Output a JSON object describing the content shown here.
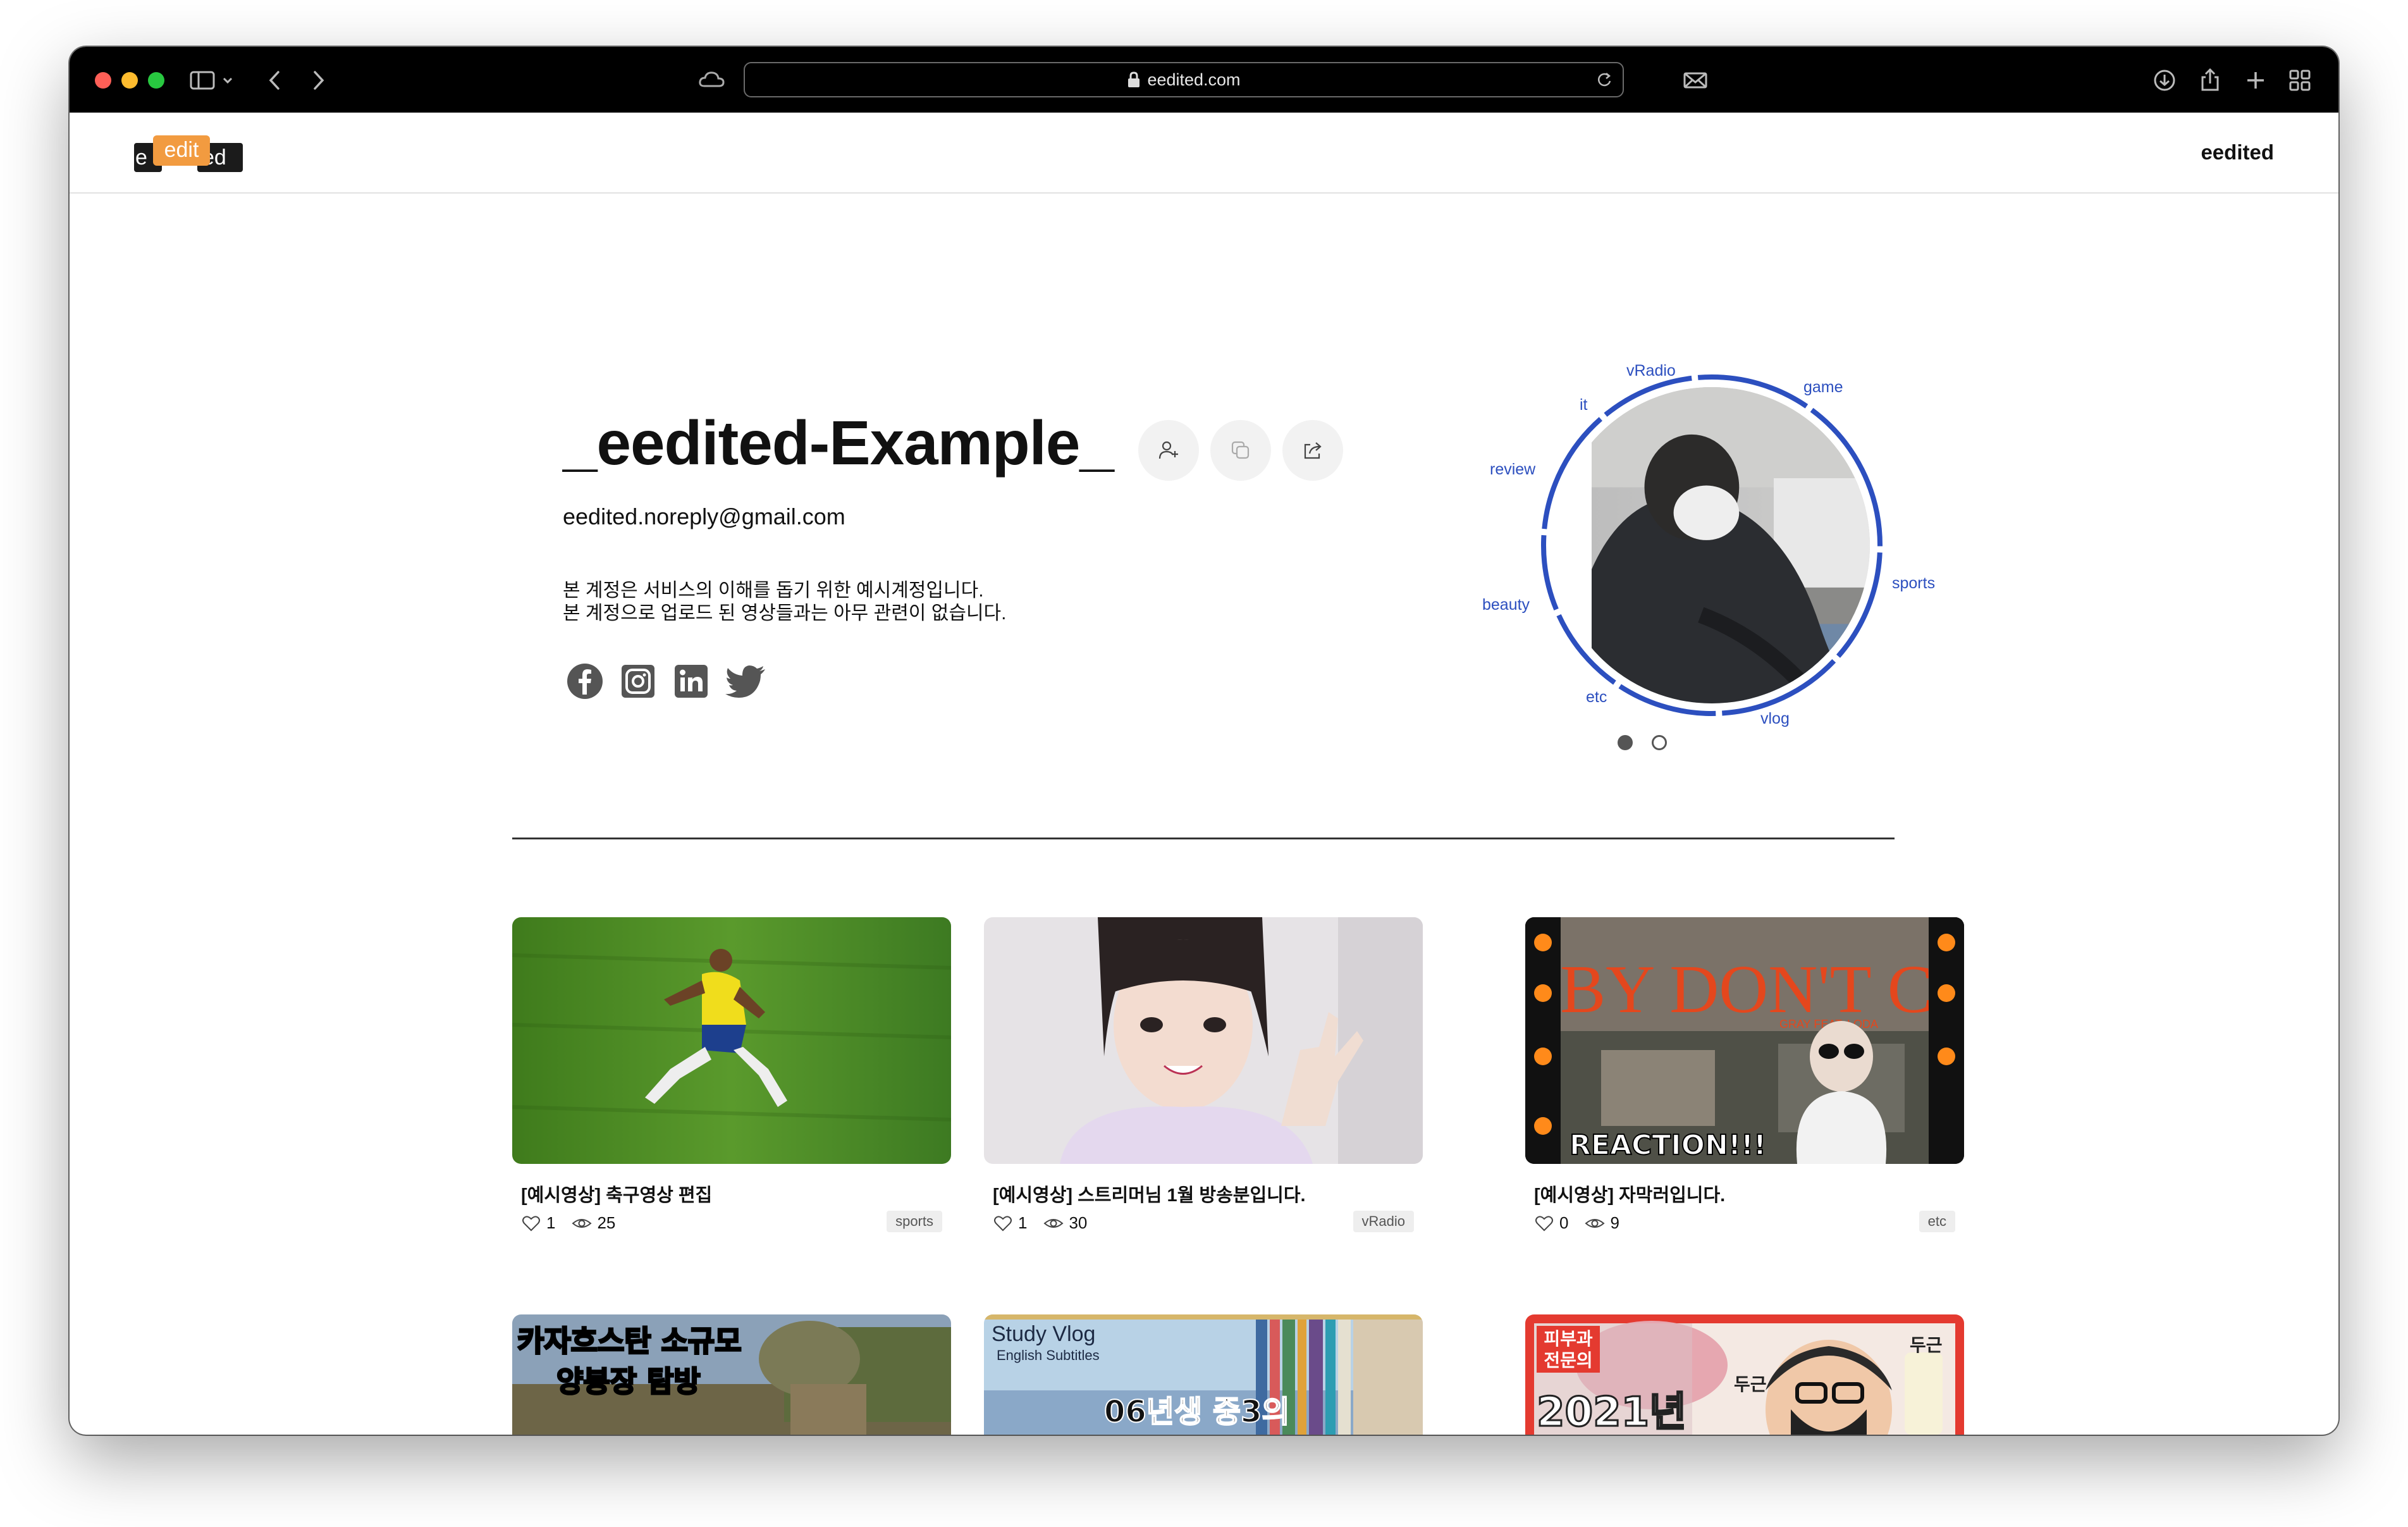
{
  "browser": {
    "url": "eedited.com",
    "traffic_colors": [
      "#ff5f57",
      "#febc2e",
      "#28c840"
    ]
  },
  "header": {
    "logo": {
      "left": "e",
      "middle": "edit",
      "right": "ed"
    },
    "brand": "eedited"
  },
  "profile": {
    "name": "_eedited-Example_",
    "email": "eedited.noreply@gmail.com",
    "bio": [
      "본 계정은 서비스의 이해를 돕기 위한 예시계정입니다.",
      "본 계정으로 업로드 된 영상들과는 아무 관련이 없습니다."
    ],
    "actions": [
      "follow-icon",
      "copy-icon",
      "share-icon"
    ],
    "social": [
      "facebook-icon",
      "instagram-icon",
      "linkedin-icon",
      "twitter-icon"
    ]
  },
  "categories": {
    "labels": [
      "vRadio",
      "game",
      "sports",
      "vlog",
      "etc",
      "beauty",
      "review",
      "it"
    ],
    "accent": "#2c4fbf",
    "pager": {
      "count": 2,
      "active": 0
    }
  },
  "videos": [
    {
      "title": "[예시영상] 축구영상 편집",
      "likes": "1",
      "views": "25",
      "tag": "sports"
    },
    {
      "title": "[예시영상] 스트리머님 1월 방송분입니다.",
      "likes": "1",
      "views": "30",
      "tag": "vRadio"
    },
    {
      "title": "[예시영상] 자막러입니다.",
      "likes": "0",
      "views": "9",
      "tag": "etc"
    }
  ],
  "thumbnail_text": {
    "t3_title": "BABY DON'T CRY",
    "t3_sub": "GRAY    FEAT. LODA",
    "t3_badge": "REACTION!!!",
    "t4_line1": "카자흐스탄 소규모",
    "t4_line2": "양봉장 탐방",
    "t5_line1": "Study Vlog",
    "t5_line2": "English Subtitles",
    "t5_line3": "06년생 중3의",
    "t6_badge1": "피부과",
    "t6_badge2": "전문의",
    "t6_year": "2021년",
    "t6_tag": "두근"
  }
}
